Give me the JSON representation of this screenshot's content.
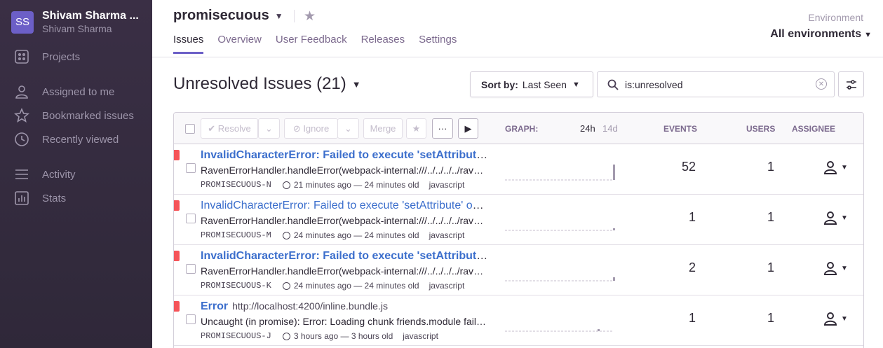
{
  "sidebar": {
    "org_initials": "SS",
    "org_name": "Shivam Sharma ...",
    "org_user": "Shivam Sharma",
    "items": [
      {
        "label": "Projects",
        "icon": "projects-icon"
      },
      {
        "label": "Assigned to me",
        "icon": "user-icon"
      },
      {
        "label": "Bookmarked issues",
        "icon": "star-icon"
      },
      {
        "label": "Recently viewed",
        "icon": "clock-icon"
      },
      {
        "label": "Activity",
        "icon": "activity-icon"
      },
      {
        "label": "Stats",
        "icon": "stats-icon"
      }
    ]
  },
  "header": {
    "project": "promisecuous",
    "tabs": [
      "Issues",
      "Overview",
      "User Feedback",
      "Releases",
      "Settings"
    ],
    "env_label": "Environment",
    "env_value": "All environments"
  },
  "toolbar": {
    "title": "Unresolved Issues (21)",
    "sort_prefix": "Sort by:",
    "sort_value": "Last Seen",
    "search_value": "is:unresolved"
  },
  "table": {
    "resolve": "Resolve",
    "ignore": "Ignore",
    "merge": "Merge",
    "more": "···",
    "graph_label": "GRAPH:",
    "graph_24h": "24h",
    "graph_14d": "14d",
    "events_label": "EVENTS",
    "users_label": "USERS",
    "assignee_label": "ASSIGNEE",
    "rows": [
      {
        "title": "InvalidCharacterError: Failed to execute 'setAttribute' on 'Element'",
        "message": "RavenErrorHandler.handleError(webpack-internal:///../../../../raven-js",
        "short_id": "PROMISECUOUS-N",
        "time": "21 minutes ago — 24 minutes old",
        "platform": "javascript",
        "events": "52",
        "users": "1"
      },
      {
        "title": "InvalidCharacterError: Failed to execute 'setAttribute' on 'Element'",
        "message": "RavenErrorHandler.handleError(webpack-internal:///../../../../raven-js",
        "short_id": "PROMISECUOUS-M",
        "time": "24 minutes ago — 24 minutes old",
        "platform": "javascript",
        "events": "1",
        "users": "1"
      },
      {
        "title": "InvalidCharacterError: Failed to execute 'setAttribute' on 'Element'",
        "message": "RavenErrorHandler.handleError(webpack-internal:///../../../../raven-js",
        "short_id": "PROMISECUOUS-K",
        "time": "24 minutes ago — 24 minutes old",
        "platform": "javascript",
        "events": "2",
        "users": "1"
      },
      {
        "title": "Error",
        "location": "http://localhost:4200/inline.bundle.js",
        "message": "Uncaught (in promise): Error: Loading chunk friends.module failed.",
        "short_id": "PROMISECUOUS-J",
        "time": "3 hours ago — 3 hours old",
        "platform": "javascript",
        "events": "1",
        "users": "1"
      }
    ]
  },
  "colors": {
    "accent": "#6c5fc7",
    "link": "#3b6ecc",
    "error": "#f55459"
  }
}
